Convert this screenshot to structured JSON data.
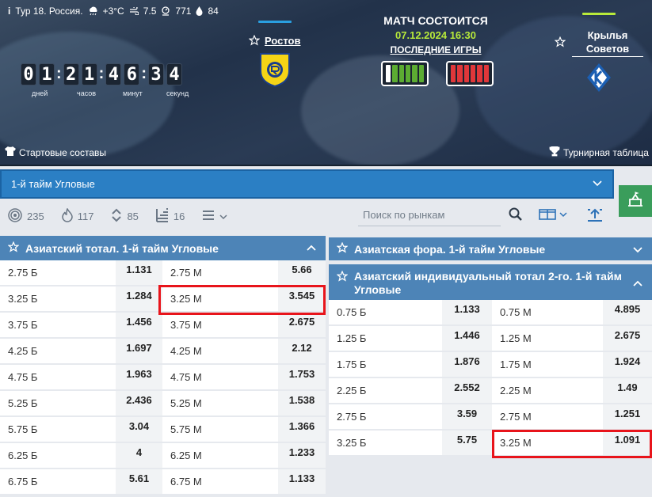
{
  "hero": {
    "tour": "Тур 18. Россия.",
    "temp": "+3°C",
    "wind": "7.5",
    "pressure": "771",
    "humidity": "84",
    "timer_digits": [
      "0",
      "1",
      "2",
      "1",
      "4",
      "6",
      "3",
      "4"
    ],
    "timer_labels": {
      "days": "дней",
      "hours": "часов",
      "minutes": "минут",
      "seconds": "секунд"
    },
    "home_team": "Ростов",
    "away_team_line1": "Крылья",
    "away_team_line2": "Советов",
    "match_status": "МАТЧ СОСТОИТСЯ",
    "match_date": "07.12.2024 16:30",
    "last_games": "ПОСЛЕДНИЕ ИГРЫ",
    "home_form": [
      "W",
      "W",
      "W",
      "W",
      "W",
      "W"
    ],
    "away_form": [
      "L",
      "L",
      "L",
      "L",
      "L",
      "L"
    ],
    "lineups": "Стартовые составы",
    "standings": "Турнирная таблица",
    "colors": {
      "accent_green": "#b8ea3a",
      "home_bar": "#2a9fe0",
      "away_bar": "#b8ea3a",
      "win": "#5cac32",
      "loss": "#e0373a",
      "highlight": "#e8141b"
    }
  },
  "market_select": {
    "label": "1-й тайм Угловые"
  },
  "filters": [
    {
      "icon": "target-icon",
      "count": "235"
    },
    {
      "icon": "fire-icon",
      "count": "117"
    },
    {
      "icon": "updown-arrows-icon",
      "count": "85"
    },
    {
      "icon": "list-stack-icon",
      "count": "16"
    }
  ],
  "search": {
    "placeholder": "Поиск по рынкам"
  },
  "left_panel": {
    "title": "Азиатский тотал. 1-й тайм Угловые",
    "rows": [
      {
        "l1": "2.75 Б",
        "o1": "1.131",
        "l2": "2.75 М",
        "o2": "5.66"
      },
      {
        "l1": "3.25 Б",
        "o1": "1.284",
        "l2": "3.25 М",
        "o2": "3.545"
      },
      {
        "l1": "3.75 Б",
        "o1": "1.456",
        "l2": "3.75 М",
        "o2": "2.675"
      },
      {
        "l1": "4.25 Б",
        "o1": "1.697",
        "l2": "4.25 М",
        "o2": "2.12"
      },
      {
        "l1": "4.75 Б",
        "o1": "1.963",
        "l2": "4.75 М",
        "o2": "1.753"
      },
      {
        "l1": "5.25 Б",
        "o1": "2.436",
        "l2": "5.25 М",
        "o2": "1.538"
      },
      {
        "l1": "5.75 Б",
        "o1": "3.04",
        "l2": "5.75 М",
        "o2": "1.366"
      },
      {
        "l1": "6.25 Б",
        "o1": "4",
        "l2": "6.25 М",
        "o2": "1.233"
      },
      {
        "l1": "6.75 Б",
        "o1": "5.61",
        "l2": "6.75 М",
        "o2": "1.133"
      }
    ]
  },
  "right_panel_1": {
    "title": "Азиатская фора. 1-й тайм Угловые"
  },
  "right_panel_2": {
    "title_line1": "Азиатский индивидуальный тотал 2-го. 1-й тайм",
    "title_line2": "Угловые",
    "rows": [
      {
        "l1": "0.75 Б",
        "o1": "1.133",
        "l2": "0.75 М",
        "o2": "4.895"
      },
      {
        "l1": "1.25 Б",
        "o1": "1.446",
        "l2": "1.25 М",
        "o2": "2.675"
      },
      {
        "l1": "1.75 Б",
        "o1": "1.876",
        "l2": "1.75 М",
        "o2": "1.924"
      },
      {
        "l1": "2.25 Б",
        "o1": "2.552",
        "l2": "2.25 М",
        "o2": "1.49"
      },
      {
        "l1": "2.75 Б",
        "o1": "3.59",
        "l2": "2.75 М",
        "o2": "1.251"
      },
      {
        "l1": "3.25 Б",
        "o1": "5.75",
        "l2": "3.25 М",
        "o2": "1.091"
      }
    ]
  }
}
